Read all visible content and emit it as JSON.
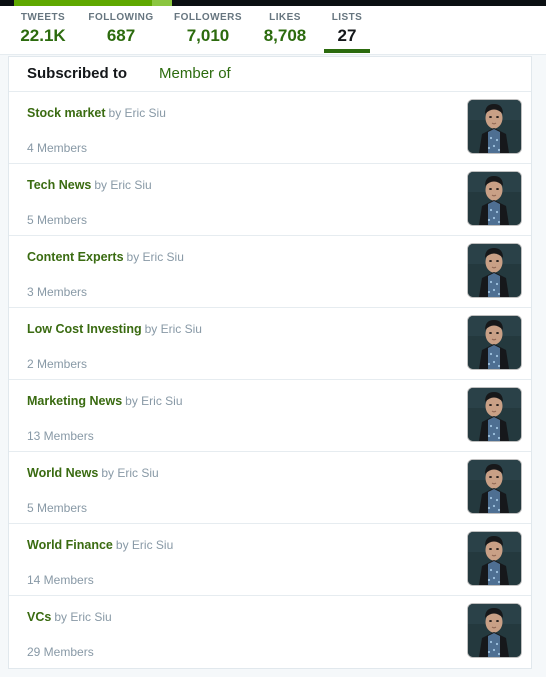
{
  "topbar": {
    "progress_percent": 30,
    "bar_color": "#5fa800",
    "tip_color": "#8bc63f",
    "background": "#0b0f12"
  },
  "stats": {
    "items": [
      {
        "label": "TWEETS",
        "value": "22.1K",
        "active": false
      },
      {
        "label": "FOLLOWING",
        "value": "687",
        "active": false
      },
      {
        "label": "FOLLOWERS",
        "value": "7,010",
        "active": false
      },
      {
        "label": "LIKES",
        "value": "8,708",
        "active": false
      },
      {
        "label": "LISTS",
        "value": "27",
        "active": true
      }
    ],
    "accent_color": "#2c6b0e",
    "label_color": "#66757f"
  },
  "card": {
    "tabs": [
      {
        "label": "Subscribed to",
        "active": true
      },
      {
        "label": "Member of",
        "active": false
      }
    ],
    "lists": [
      {
        "name": "Stock market",
        "by": "by Eric Siu",
        "members": "4 Members",
        "avatar": "eric-siu-avatar"
      },
      {
        "name": "Tech News",
        "by": "by Eric Siu",
        "members": "5 Members",
        "avatar": "eric-siu-avatar"
      },
      {
        "name": "Content Experts",
        "by": "by Eric Siu",
        "members": "3 Members",
        "avatar": "eric-siu-avatar"
      },
      {
        "name": "Low Cost Investing",
        "by": "by Eric Siu",
        "members": "2 Members",
        "avatar": "eric-siu-avatar"
      },
      {
        "name": "Marketing News",
        "by": "by Eric Siu",
        "members": "13 Members",
        "avatar": "eric-siu-avatar"
      },
      {
        "name": "World News",
        "by": "by Eric Siu",
        "members": "5 Members",
        "avatar": "eric-siu-avatar"
      },
      {
        "name": "World Finance",
        "by": "by Eric Siu",
        "members": "14 Members",
        "avatar": "eric-siu-avatar"
      },
      {
        "name": "VCs",
        "by": "by Eric Siu",
        "members": "29 Members",
        "avatar": "eric-siu-avatar"
      }
    ]
  }
}
